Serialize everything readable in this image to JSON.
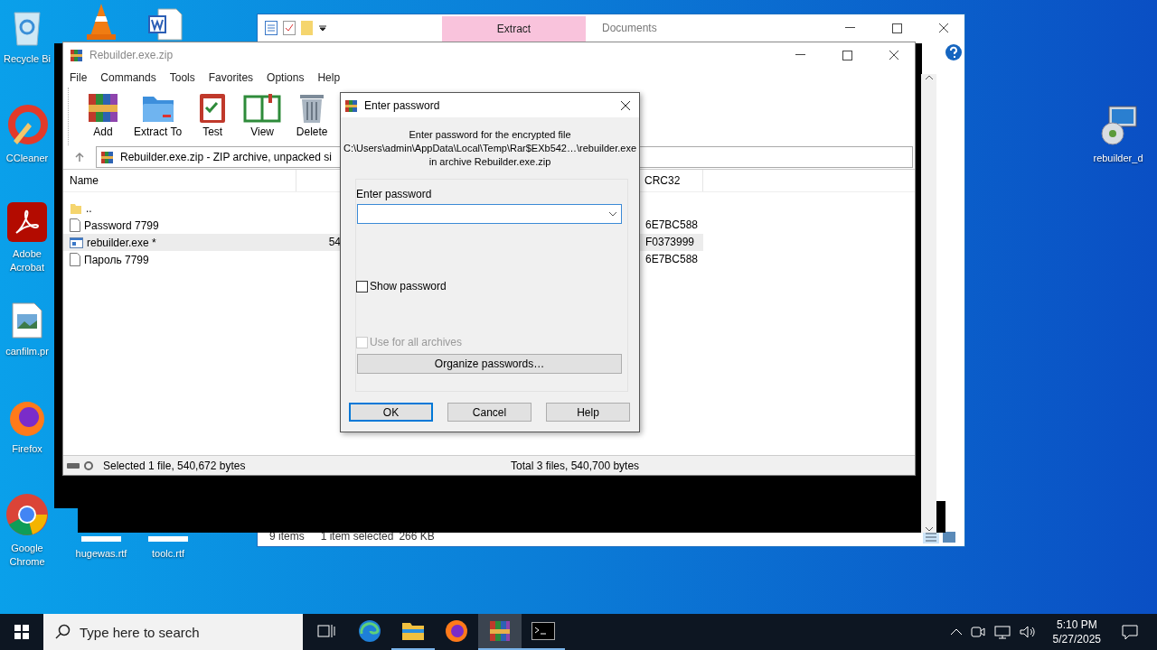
{
  "desktop_icons": [
    {
      "kind": "recycle",
      "label": "Recycle Bi"
    },
    {
      "kind": "cone"
    },
    {
      "kind": "word"
    },
    {
      "kind": "ccleaner",
      "label": "CCleaner"
    },
    {
      "kind": "acrobat",
      "label": "Adobe Acrobat"
    },
    {
      "kind": "image",
      "label": "canfilm.pr"
    },
    {
      "kind": "firefox",
      "label": "Firefox"
    },
    {
      "kind": "chrome",
      "label": "Google Chrome"
    },
    {
      "kind": "rtf",
      "label": "hugewas.rtf"
    },
    {
      "kind": "rtf",
      "label": "toolc.rtf"
    },
    {
      "kind": "setup",
      "label": "rebuilder_d"
    }
  ],
  "explorer": {
    "ribbon_tab": "Extract",
    "title": "Documents",
    "status": [
      "9 items",
      "1 item selected",
      "266 KB"
    ]
  },
  "archive_window": {
    "title": "Rebuilder.exe.zip",
    "menu": [
      "File",
      "Commands",
      "Tools",
      "Favorites",
      "Options",
      "Help"
    ],
    "toolbar": [
      {
        "kind": "add",
        "label": "Add"
      },
      {
        "kind": "extract",
        "label": "Extract To"
      },
      {
        "kind": "test",
        "label": "Test"
      },
      {
        "kind": "view",
        "label": "View"
      },
      {
        "kind": "delete",
        "label": "Delete"
      }
    ],
    "address": "Rebuilder.exe.zip - ZIP archive, unpacked si",
    "name_header": "Name",
    "crc_header": "CRC32",
    "rows": [
      {
        "kind": "folder",
        "name": "..",
        "selected": false
      },
      {
        "kind": "doc",
        "name": "Password 7799",
        "crc": "6E7BC588",
        "selected": false
      },
      {
        "kind": "exe",
        "name": "rebuilder.exe *",
        "size": "54",
        "crc": "F0373999",
        "selected": true
      },
      {
        "kind": "doc",
        "name": "Пароль 7799",
        "crc": "6E7BC588",
        "selected": false
      }
    ],
    "status_left": "Selected 1 file, 540,672 bytes",
    "status_right": "Total 3 files, 540,700 bytes"
  },
  "dialog": {
    "title": "Enter password",
    "message": [
      "Enter password for the encrypted file",
      "C:\\Users\\admin\\AppData\\Local\\Temp\\Rar$EXb542…\\rebuilder.exe",
      "in archive Rebuilder.exe.zip"
    ],
    "field_label": "Enter password",
    "checkboxes": [
      {
        "label": "Show password",
        "checked": false,
        "disabled": false
      },
      {
        "label": "Use for all archives",
        "checked": false,
        "disabled": true
      }
    ],
    "organize_button": "Organize passwords…",
    "buttons": [
      {
        "label": "OK",
        "default": true
      },
      {
        "label": "Cancel",
        "default": false
      },
      {
        "label": "Help",
        "default": false
      }
    ]
  },
  "taskbar": {
    "search_placeholder": "Type here to search",
    "apps": [
      {
        "kind": "taskview",
        "running": false,
        "active": false
      },
      {
        "kind": "edge",
        "running": false,
        "active": false
      },
      {
        "kind": "folder",
        "running": true,
        "active": false
      },
      {
        "kind": "firefox",
        "running": false,
        "active": false
      },
      {
        "kind": "archive",
        "running": true,
        "active": true
      },
      {
        "kind": "terminal",
        "running": true,
        "active": false
      }
    ],
    "time": "5:10 PM",
    "date": "5/27/2025"
  }
}
